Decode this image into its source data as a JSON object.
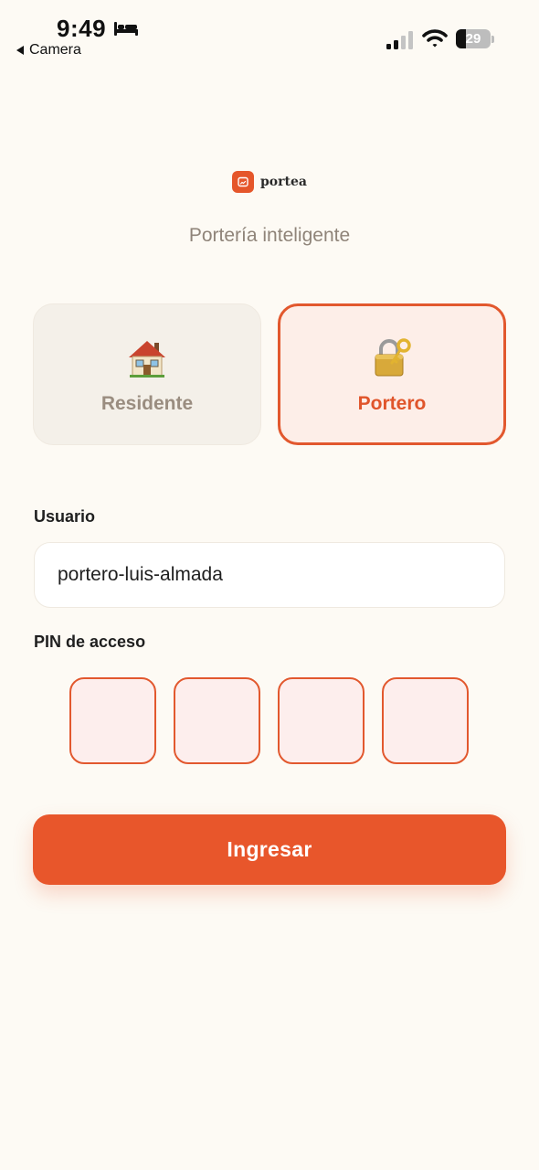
{
  "status_bar": {
    "time": "9:49",
    "back_app_label": "Camera",
    "battery_level": "29",
    "battery_fraction": 0.29
  },
  "brand": {
    "name": "portea",
    "tagline": "Portería inteligente",
    "accent_color": "#e8562b"
  },
  "roles": [
    {
      "label": "Residente",
      "icon": "house-icon",
      "selected": false
    },
    {
      "label": "Portero",
      "icon": "lock-key-icon",
      "selected": true
    }
  ],
  "form": {
    "usuario_label": "Usuario",
    "usuario_value": "portero-luis-almada",
    "pin_label": "PIN de acceso",
    "pin_digits": [
      "",
      "",
      "",
      ""
    ],
    "submit_label": "Ingresar"
  }
}
